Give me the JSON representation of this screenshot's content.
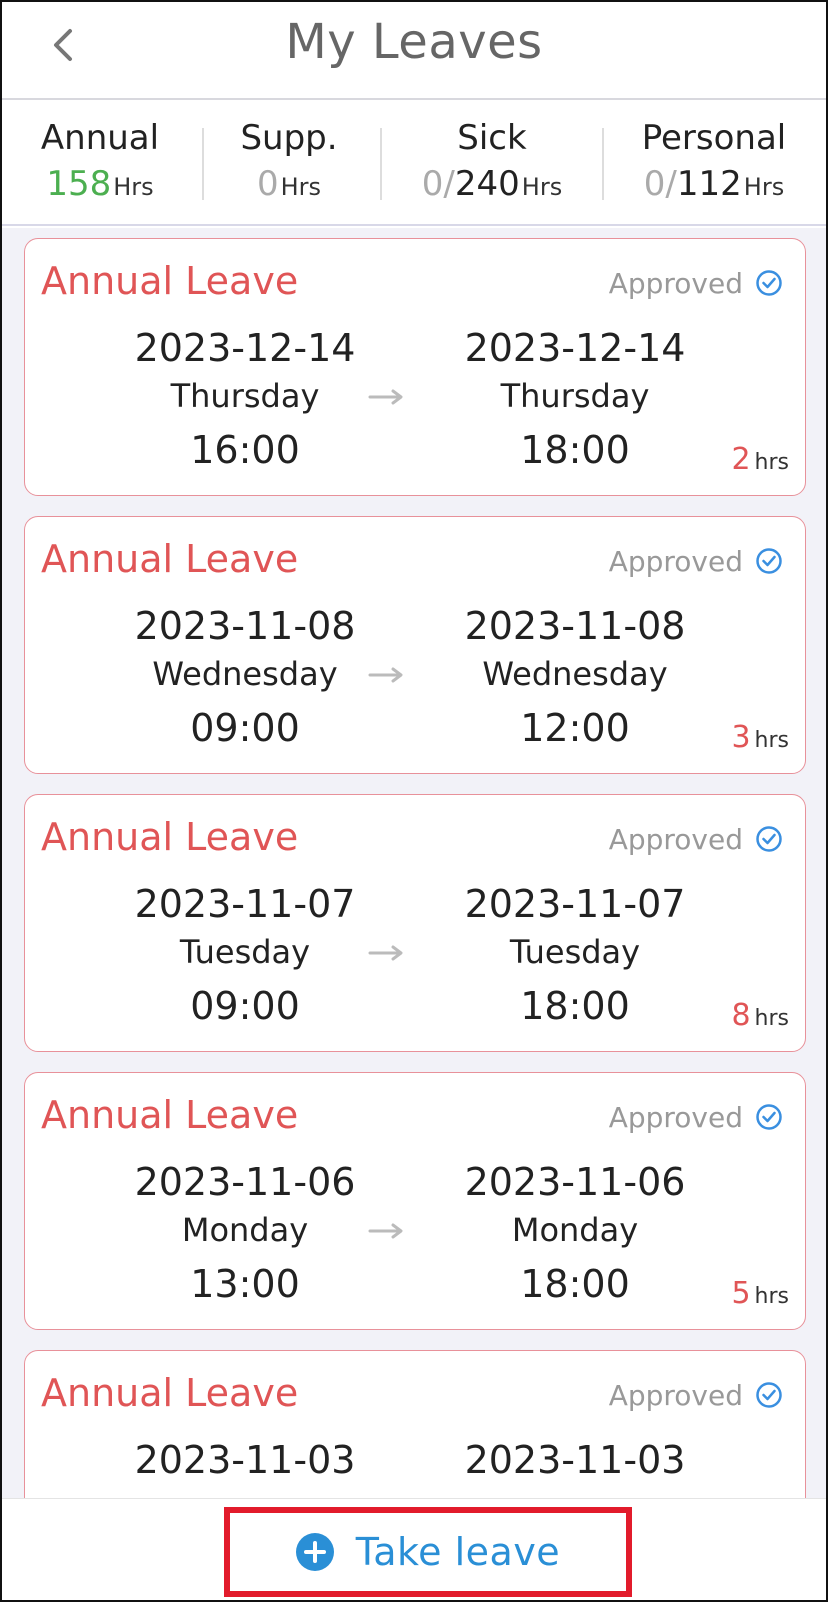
{
  "header": {
    "title": "My Leaves"
  },
  "summary": {
    "annual": {
      "label": "Annual",
      "value": "158",
      "unit": "Hrs"
    },
    "supp": {
      "label": "Supp.",
      "value": "0",
      "unit": "Hrs"
    },
    "sick": {
      "label": "Sick",
      "used": "0/",
      "total": "240",
      "unit": "Hrs"
    },
    "personal": {
      "label": "Personal",
      "used": "0/",
      "total": "112",
      "unit": "Hrs"
    }
  },
  "leaves": [
    {
      "type": "Annual Leave",
      "status": "Approved",
      "from": {
        "date": "2023-12-14",
        "day": "Thursday",
        "time": "16:00"
      },
      "to": {
        "date": "2023-12-14",
        "day": "Thursday",
        "time": "18:00"
      },
      "hours": "2",
      "unit": "hrs"
    },
    {
      "type": "Annual Leave",
      "status": "Approved",
      "from": {
        "date": "2023-11-08",
        "day": "Wednesday",
        "time": "09:00"
      },
      "to": {
        "date": "2023-11-08",
        "day": "Wednesday",
        "time": "12:00"
      },
      "hours": "3",
      "unit": "hrs"
    },
    {
      "type": "Annual Leave",
      "status": "Approved",
      "from": {
        "date": "2023-11-07",
        "day": "Tuesday",
        "time": "09:00"
      },
      "to": {
        "date": "2023-11-07",
        "day": "Tuesday",
        "time": "18:00"
      },
      "hours": "8",
      "unit": "hrs"
    },
    {
      "type": "Annual Leave",
      "status": "Approved",
      "from": {
        "date": "2023-11-06",
        "day": "Monday",
        "time": "13:00"
      },
      "to": {
        "date": "2023-11-06",
        "day": "Monday",
        "time": "18:00"
      },
      "hours": "5",
      "unit": "hrs"
    },
    {
      "type": "Annual Leave",
      "status": "Approved",
      "from": {
        "date": "2023-11-03",
        "day": "",
        "time": ""
      },
      "to": {
        "date": "2023-11-03",
        "day": "",
        "time": ""
      },
      "hours": "",
      "unit": ""
    }
  ],
  "footer": {
    "take_leave_label": "Take leave"
  },
  "colors": {
    "accent_red": "#e05556",
    "approved_blue": "#3a8fe0",
    "annual_green": "#4caf50",
    "button_blue": "#2a8fd6",
    "highlight_red": "#e21b2b"
  },
  "icons": {
    "back": "chevron-left-icon",
    "approved": "check-circle-icon",
    "arrow": "right-arrow-icon",
    "add": "plus-circle-icon"
  }
}
